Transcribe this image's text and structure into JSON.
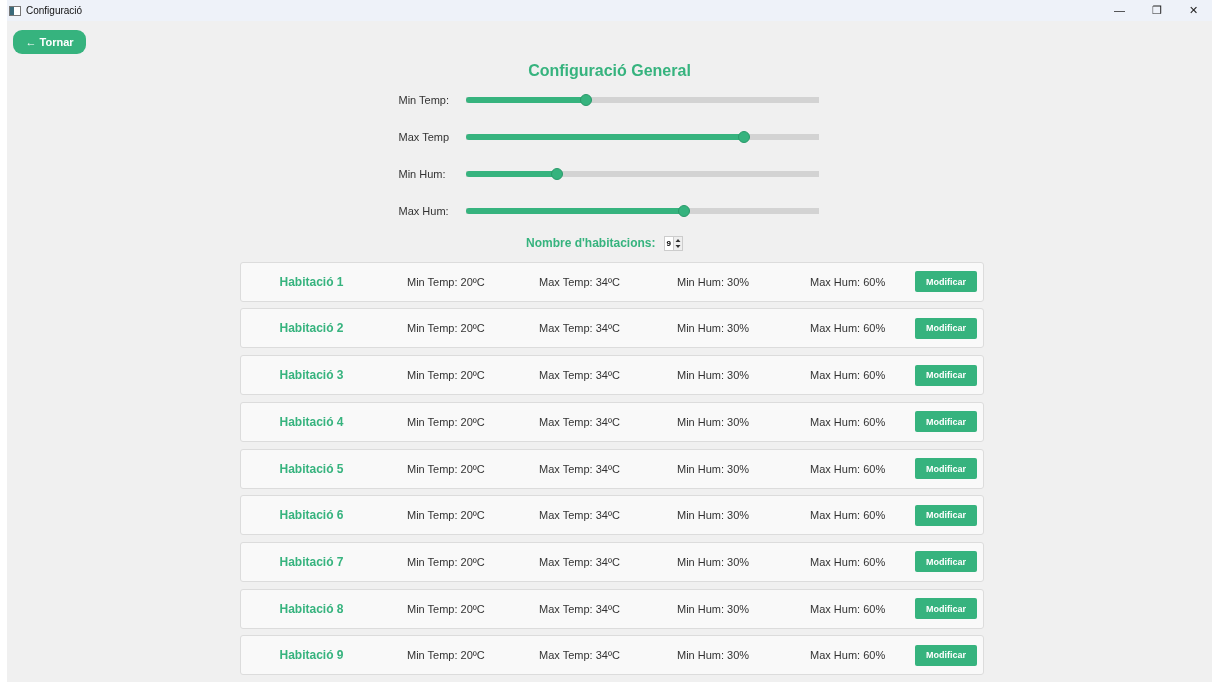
{
  "window": {
    "title": "Configuració",
    "controls": [
      "—",
      "❐",
      "✕"
    ]
  },
  "back_button": "← Tornar",
  "heading": "Configuració General",
  "sliders": [
    {
      "label": "Min Temp:",
      "level": 0.34
    },
    {
      "label": "Max Temp",
      "level": 0.79
    },
    {
      "label": "Min Hum:",
      "level": 0.26
    },
    {
      "label": "Max Hum:",
      "level": 0.62
    }
  ],
  "room_count": {
    "label": "Nombre d'habitacions:",
    "value": "9"
  },
  "rooms": [
    {
      "name": "Habitació 1",
      "min_temp": "Min Temp: 20ºC",
      "max_temp": "Max Temp: 34ºC",
      "min_hum": "Min Hum: 30%",
      "max_hum": "Max Hum: 60%",
      "button": "Modificar"
    },
    {
      "name": "Habitació 2",
      "min_temp": "Min Temp: 20ºC",
      "max_temp": "Max Temp: 34ºC",
      "min_hum": "Min Hum: 30%",
      "max_hum": "Max Hum: 60%",
      "button": "Modificar"
    },
    {
      "name": "Habitació 3",
      "min_temp": "Min Temp: 20ºC",
      "max_temp": "Max Temp: 34ºC",
      "min_hum": "Min Hum: 30%",
      "max_hum": "Max Hum: 60%",
      "button": "Modificar"
    },
    {
      "name": "Habitació 4",
      "min_temp": "Min Temp: 20ºC",
      "max_temp": "Max Temp: 34ºC",
      "min_hum": "Min Hum: 30%",
      "max_hum": "Max Hum: 60%",
      "button": "Modificar"
    },
    {
      "name": "Habitació 5",
      "min_temp": "Min Temp: 20ºC",
      "max_temp": "Max Temp: 34ºC",
      "min_hum": "Min Hum: 30%",
      "max_hum": "Max Hum: 60%",
      "button": "Modificar"
    },
    {
      "name": "Habitació 6",
      "min_temp": "Min Temp: 20ºC",
      "max_temp": "Max Temp: 34ºC",
      "min_hum": "Min Hum: 30%",
      "max_hum": "Max Hum: 60%",
      "button": "Modificar"
    },
    {
      "name": "Habitació 7",
      "min_temp": "Min Temp: 20ºC",
      "max_temp": "Max Temp: 34ºC",
      "min_hum": "Min Hum: 30%",
      "max_hum": "Max Hum: 60%",
      "button": "Modificar"
    },
    {
      "name": "Habitació 8",
      "min_temp": "Min Temp: 20ºC",
      "max_temp": "Max Temp: 34ºC",
      "min_hum": "Min Hum: 30%",
      "max_hum": "Max Hum: 60%",
      "button": "Modificar"
    },
    {
      "name": "Habitació 9",
      "min_temp": "Min Temp: 20ºC",
      "max_temp": "Max Temp: 34ºC",
      "min_hum": "Min Hum: 30%",
      "max_hum": "Max Hum: 60%",
      "button": "Modificar"
    }
  ]
}
